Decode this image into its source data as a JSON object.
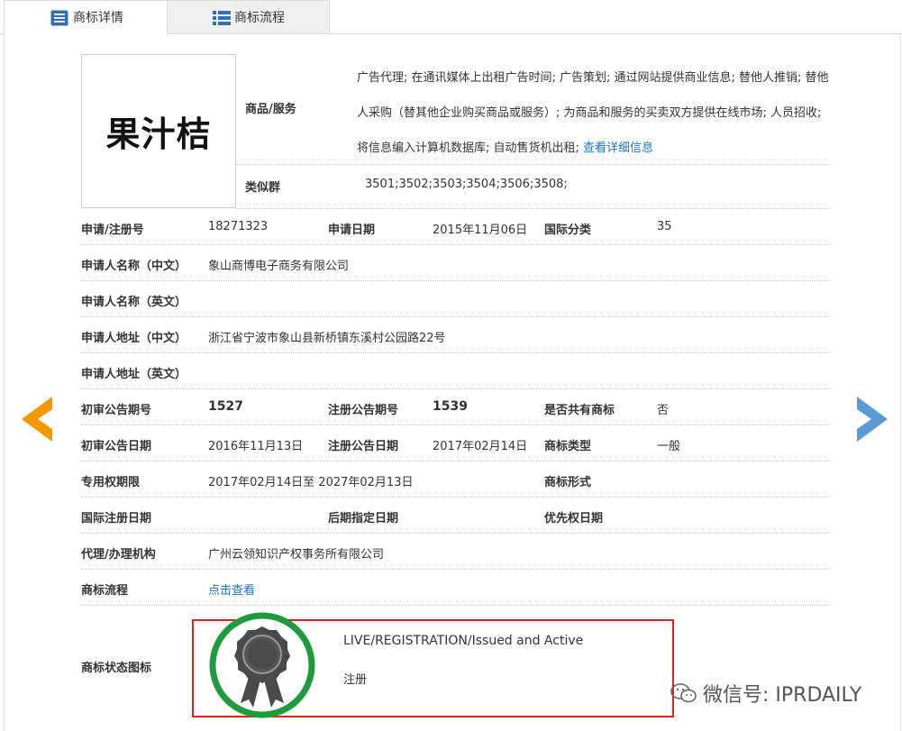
{
  "tabs": [
    {
      "label": "商标详情",
      "active": true,
      "icon": "detail-icon"
    },
    {
      "label": "商标流程",
      "active": false,
      "icon": "list-icon"
    }
  ],
  "logo_text": "果汁桔",
  "goods_services": {
    "label": "商品/服务",
    "text": "广告代理; 在通讯媒体上出租广告时间; 广告策划; 通过网站提供商业信息; 替他人推销; 替他人采购（替其他企业购买商品或服务）; 为商品和服务的买卖双方提供在线市场; 人员招收; 将信息编入计算机数据库; 自动售货机出租; ",
    "link": "查看详细信息"
  },
  "similar_group": {
    "label": "类似群",
    "value": "3501;3502;3503;3504;3506;3508;"
  },
  "fields": {
    "reg_no": {
      "label": "申请/注册号",
      "value": "18271323"
    },
    "app_date": {
      "label": "申请日期",
      "value": "2015年11月06日"
    },
    "intl_class": {
      "label": "国际分类",
      "value": "35"
    },
    "applicant_cn": {
      "label": "申请人名称（中文）",
      "value": "象山商博电子商务有限公司"
    },
    "applicant_en": {
      "label": "申请人名称（英文）",
      "value": ""
    },
    "address_cn": {
      "label": "申请人地址（中文）",
      "value": "浙江省宁波市象山县新桥镇东溪村公园路22号"
    },
    "address_en": {
      "label": "申请人地址（英文）",
      "value": ""
    },
    "prelim_no": {
      "label": "初审公告期号",
      "value": "1527"
    },
    "reg_pub_no": {
      "label": "注册公告期号",
      "value": "1539"
    },
    "shared": {
      "label": "是否共有商标",
      "value": "否"
    },
    "prelim_date": {
      "label": "初审公告日期",
      "value": "2016年11月13日"
    },
    "reg_pub_date": {
      "label": "注册公告日期",
      "value": "2017年02月14日"
    },
    "tm_type": {
      "label": "商标类型",
      "value": "一般"
    },
    "exclusive_period": {
      "label": "专用权期限",
      "value": "2017年02月14日至 2027年02月13日"
    },
    "tm_form": {
      "label": "商标形式",
      "value": ""
    },
    "intl_reg_date": {
      "label": "国际注册日期",
      "value": ""
    },
    "later_date": {
      "label": "后期指定日期",
      "value": ""
    },
    "priority_date": {
      "label": "优先权日期",
      "value": ""
    },
    "agent": {
      "label": "代理/办理机构",
      "value": "广州云领知识产权事务所有限公司"
    },
    "process": {
      "label": "商标流程",
      "value": "点击查看"
    },
    "status_icon": {
      "label": "商标状态图标"
    }
  },
  "status": {
    "en": "LIVE/REGISTRATION/Issued and Active",
    "cn": "注册",
    "ring_color": "#1e9b3c",
    "box_color": "#e0241b"
  },
  "nav": {
    "prev_color": "#f39800",
    "next_color": "#5b9bd5"
  },
  "watermark": "微信号: IPRDAILY"
}
